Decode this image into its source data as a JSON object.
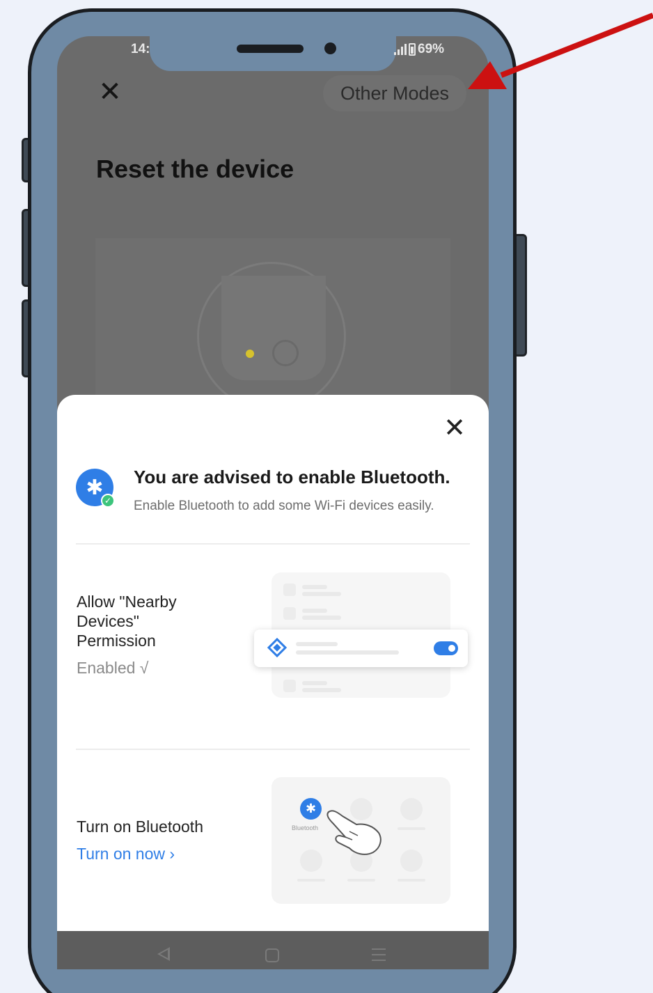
{
  "status_bar": {
    "time": "14:",
    "battery": "69%"
  },
  "header": {
    "close_icon": "close-icon",
    "other_modes_label": "Other Modes"
  },
  "page": {
    "title": "Reset the device"
  },
  "bluetooth_sheet": {
    "title": "You are advised to enable Bluetooth.",
    "subtitle": "Enable Bluetooth to add some Wi-Fi devices easily.",
    "permission": {
      "label": "Allow \"Nearby Devices\" Permission",
      "status": "Enabled √"
    },
    "turn_on": {
      "label": "Turn on Bluetooth",
      "link": "Turn on now ›"
    },
    "illustration_label": "Bluetooth"
  },
  "annotation": {
    "arrow_color": "#cc1111"
  },
  "colors": {
    "accent": "#2f7ee6",
    "phone_frame": "#6f8aa5",
    "success": "#3cc47c"
  }
}
